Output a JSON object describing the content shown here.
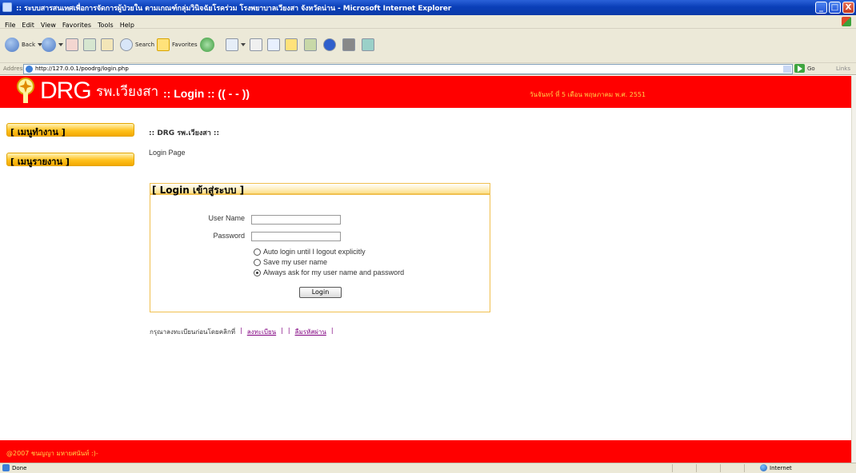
{
  "window": {
    "title": ":: ระบบสารสนเทศเพื่อการจัดการผู้ป่วยใน ตามเกณฑ์กลุ่มวินิจฉัยโรคร่วม โรงพยาบาลเวียงสา จังหวัดน่าน - Microsoft Internet Explorer",
    "controls": [
      "_",
      "□",
      "X"
    ]
  },
  "menu": [
    "File",
    "Edit",
    "View",
    "Favorites",
    "Tools",
    "Help"
  ],
  "toolbar": {
    "back_label": "Back",
    "search_label": "Search",
    "favorites_label": "Favorites"
  },
  "address_bar": {
    "label": "Address",
    "url": "http://127.0.0.1/poodrg/login.php",
    "go_label": "Go",
    "links_label": "Links"
  },
  "header": {
    "logo_text": "DRG",
    "logo_sub": "รพ.เวียงสา",
    "title": ":: Login :: (( - - ))",
    "date": "วันจันทร์ ที่ 5 เดือน พฤษภาคม พ.ศ. 2551"
  },
  "sidebar": {
    "items": [
      {
        "label": "[ เมนูทำงาน ]"
      },
      {
        "label": "[ เมนูรายงาน ]"
      }
    ]
  },
  "main": {
    "breadcrumb": ":: DRG รพ.เวียงสา ::",
    "page_label": "Login Page"
  },
  "login": {
    "title": "[ Login เข้าสู่ระบบ ]",
    "username_label": "User Name",
    "password_label": "Password",
    "username_value": "",
    "password_value": "",
    "options": [
      {
        "label": "Auto login until I logout explicitly",
        "selected": false
      },
      {
        "label": "Save my user name",
        "selected": false
      },
      {
        "label": "Always ask for my user name and password",
        "selected": true
      }
    ],
    "button_label": "Login"
  },
  "register": {
    "prompt": "กรุณาลงทะเบียนก่อนโดยคลิกที่",
    "separator": "|",
    "register_link": "ลงทะเบียน",
    "forgot_link": "ลืมรหัสผ่าน"
  },
  "footer": {
    "text": "@2007 ชนญญา มหายศนันท์ :)-"
  },
  "status_bar": {
    "left": "Done",
    "zone": "Internet"
  },
  "colors": {
    "header_red": "#ff0000",
    "accent_yellow": "#ffc21e",
    "xp_blue": "#0a3fb8"
  }
}
